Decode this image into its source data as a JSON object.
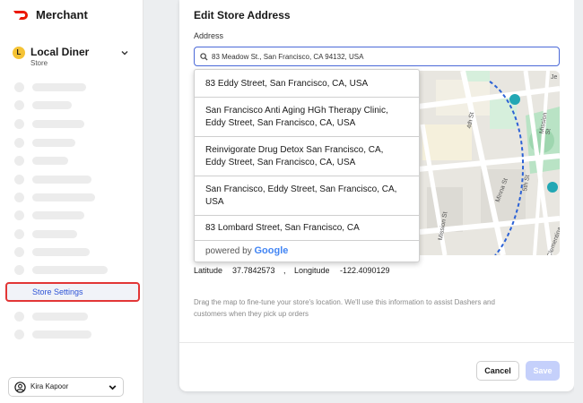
{
  "brand": {
    "name": "Merchant",
    "logo_icon": "doordash-logo-icon",
    "color": "#eb1700"
  },
  "store": {
    "initial": "L",
    "name": "Local Diner",
    "subtitle": "Store",
    "chevron_icon": "chevron-down-icon"
  },
  "sidebar": {
    "active_item": {
      "label": "Store Settings",
      "highlight_color": "#e23636",
      "text_color": "#2d53d6"
    }
  },
  "user": {
    "name": "Kira Kapoor",
    "icon": "account-circle-icon",
    "chevron_icon": "chevron-down-icon"
  },
  "modal": {
    "title": "Edit Store Address",
    "address_label": "Address",
    "address_value": "83 Meadow St., San Francisco, CA 94132, USA",
    "suggestions": [
      {
        "lines": [
          "83 Eddy Street, San Francisco, CA, USA"
        ]
      },
      {
        "lines": [
          "San Francisco Anti Aging HGh Therapy Clinic,",
          "Eddy Street, San Francisco, CA, USA"
        ]
      },
      {
        "lines": [
          "Reinvigorate Drug Detox San Francisco, CA,",
          "Eddy Street, San Francisco, CA, USA"
        ]
      },
      {
        "lines": [
          "San Francisco, Eddy Street, San Francisco, CA,",
          "USA"
        ]
      },
      {
        "lines": [
          "83 Lombard Street, San Francisco, CA"
        ]
      }
    ],
    "powered_by": "powered by",
    "google": "Google",
    "map_labels": [
      "4th St",
      "5th St",
      "Mission St",
      "Minna St",
      "Mission St",
      "Clementina",
      "Je"
    ],
    "latitude_label": "Latitude",
    "latitude_value": "37.7842573",
    "separator": ",",
    "longitude_label": "Longitude",
    "longitude_value": "-122.4090129",
    "helper_line1": "Drag the map to fine-tune your store's location. We'll use this information to assist Dashers and",
    "helper_line2": "customers when they pick up orders",
    "cancel_label": "Cancel",
    "save_label": "Save",
    "accent_color": "#4b69d8"
  }
}
